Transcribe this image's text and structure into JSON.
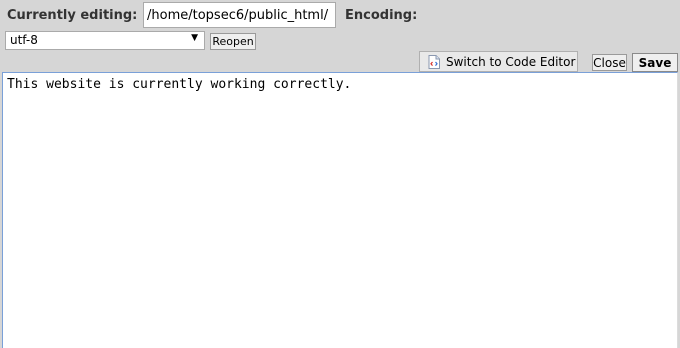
{
  "toolbar": {
    "currently_editing_label": "Currently editing:",
    "path_value": "/home/topsec6/public_html/",
    "encoding_label": "Encoding:",
    "encoding_selected": "utf-8",
    "reopen_label": "Reopen",
    "switch_label": "Switch to Code Editor",
    "close_label": "Close",
    "save_label": "Save"
  },
  "editor": {
    "content": "This website is currently working correctly."
  }
}
